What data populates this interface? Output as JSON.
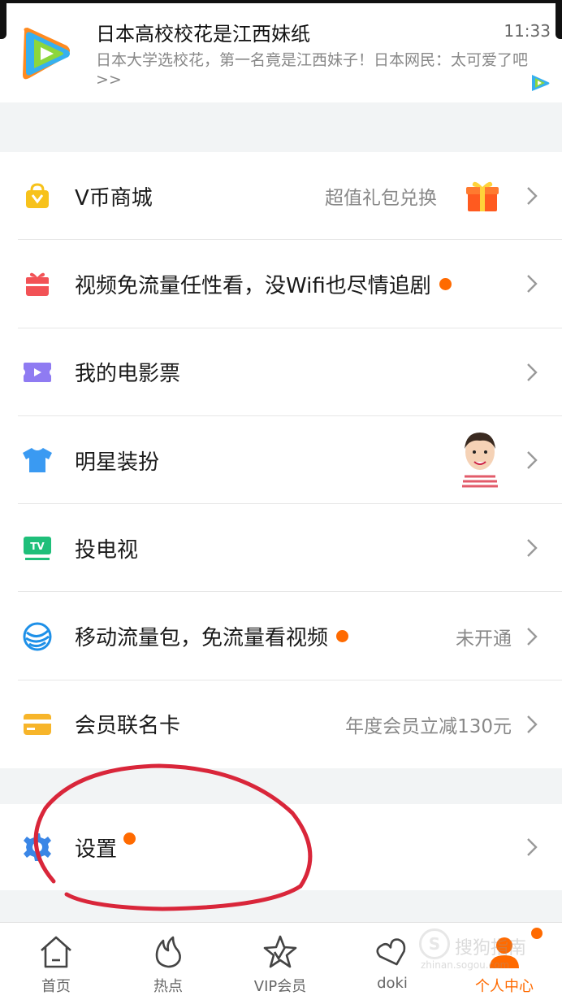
{
  "notification": {
    "title": "日本高校校花是江西妹纸",
    "time": "11:33",
    "body": "日本大学选校花，第一名竟是江西妹子！日本网民：太可爱了吧>>",
    "app_icon": "tencent-video-icon"
  },
  "menu": {
    "items": [
      {
        "label": "V币商城",
        "icon": "shopping-bag-icon",
        "right_text": "超值礼包兑换",
        "badge": false,
        "extra": "gift-icon"
      },
      {
        "label": "视频免流量任性看，没Wifi也尽情追剧",
        "icon": "gift-box-icon",
        "right_text": "",
        "badge": true
      },
      {
        "label": "我的电影票",
        "icon": "ticket-icon",
        "right_text": "",
        "badge": false
      },
      {
        "label": "明星装扮",
        "icon": "tshirt-icon",
        "right_text": "",
        "badge": false,
        "extra": "star-avatar"
      },
      {
        "label": "投电视",
        "icon": "tv-icon",
        "right_text": "",
        "badge": false
      },
      {
        "label": "移动流量包，免流量看视频",
        "icon": "china-mobile-icon",
        "right_text": "未开通",
        "badge": true
      },
      {
        "label": "会员联名卡",
        "icon": "card-icon",
        "right_text": "年度会员立减130元",
        "badge": false
      }
    ],
    "settings": {
      "label": "设置",
      "icon": "gear-icon",
      "badge": true
    }
  },
  "tabbar": {
    "tabs": [
      {
        "label": "首页",
        "icon": "home-icon",
        "active": false
      },
      {
        "label": "热点",
        "icon": "flame-icon",
        "active": false
      },
      {
        "label": "VIP会员",
        "icon": "vip-star-icon",
        "active": false
      },
      {
        "label": "doki",
        "icon": "doki-heart-icon",
        "active": false
      },
      {
        "label": "个人中心",
        "icon": "person-icon",
        "active": true,
        "badge": true
      }
    ]
  },
  "watermark": {
    "brand": "搜狗指南",
    "url": "zhinan.sogou.com"
  },
  "colors": {
    "accent": "#ff6a00",
    "background": "#f2f4f5",
    "annotation": "#d9263a"
  }
}
